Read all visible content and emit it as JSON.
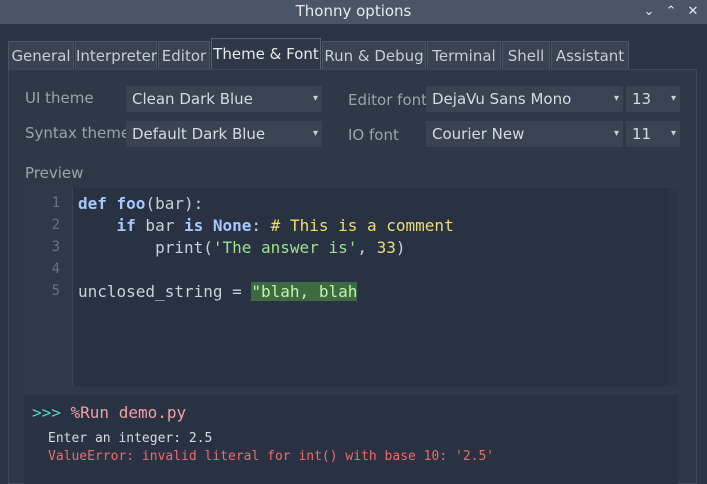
{
  "window": {
    "title": "Thonny options"
  },
  "tabs": [
    {
      "label": "General"
    },
    {
      "label": "Interpreter"
    },
    {
      "label": "Editor"
    },
    {
      "label": "Theme & Font"
    },
    {
      "label": "Run & Debug"
    },
    {
      "label": "Terminal"
    },
    {
      "label": "Shell"
    },
    {
      "label": "Assistant"
    }
  ],
  "active_tab": "Theme & Font",
  "settings": {
    "ui_theme_label": "UI theme",
    "ui_theme_value": "Clean Dark Blue",
    "syntax_theme_label": "Syntax theme",
    "syntax_theme_value": "Default Dark Blue",
    "editor_font_label": "Editor font",
    "editor_font_value": "DejaVu Sans Mono",
    "editor_font_size": "13",
    "io_font_label": "IO font",
    "io_font_value": "Courier New",
    "io_font_size": "11"
  },
  "preview": {
    "label": "Preview",
    "line_numbers": [
      "1",
      "2",
      "3",
      "4",
      "5"
    ],
    "line1": {
      "kw": "def",
      "name": " foo",
      "rest": "(bar):"
    },
    "line2": {
      "indent": "    ",
      "kw_if": "if",
      "mid": " bar ",
      "kw_is": "is",
      "sp": " ",
      "none": "None",
      "colon": ": ",
      "comment": "# This is a comment"
    },
    "line3": {
      "indent": "        ",
      "fn": "print(",
      "str": "'The answer is'",
      "sep": ", ",
      "num": "33",
      "close": ")"
    },
    "line5": {
      "lhs": "unclosed_string = ",
      "open_str": "\"blah, blah"
    }
  },
  "shell": {
    "prompt": ">>> ",
    "command": "%Run demo.py",
    "output": "Enter an integer: 2.5",
    "error": "ValueError: invalid literal for int() with base 10: '2.5'"
  },
  "colors": {
    "background": "#2b3544",
    "keyword": "#a8c7ff",
    "string": "#9ee28a",
    "comment": "#f0dd6a",
    "error": "#f06a6a",
    "prompt": "#58d4c8"
  }
}
